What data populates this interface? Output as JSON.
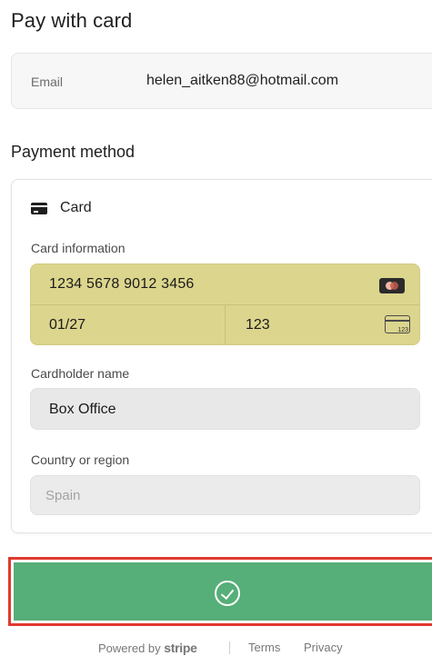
{
  "header": {
    "title": "Pay with card"
  },
  "email": {
    "label": "Email",
    "value": "helen_aitken88@hotmail.com"
  },
  "payment_method": {
    "title": "Payment method",
    "method_label": "Card",
    "card_information": {
      "label": "Card information",
      "number": "1234 5678 9012 3456",
      "expiry": "01/27",
      "cvc": "123",
      "cvc_icon_text": "123",
      "brand_icon": "card-brand-icon",
      "field_color": "#dcd58d"
    },
    "cardholder": {
      "label": "Cardholder name",
      "value": "Box Office"
    },
    "country": {
      "label": "Country or region",
      "value": "Spain"
    }
  },
  "pay_button": {
    "icon": "check-circle-icon",
    "color": "#56ae78",
    "highlight_color": "#e03a2e"
  },
  "footer": {
    "powered_by": "Powered by",
    "brand": "stripe",
    "terms": "Terms",
    "privacy": "Privacy"
  }
}
